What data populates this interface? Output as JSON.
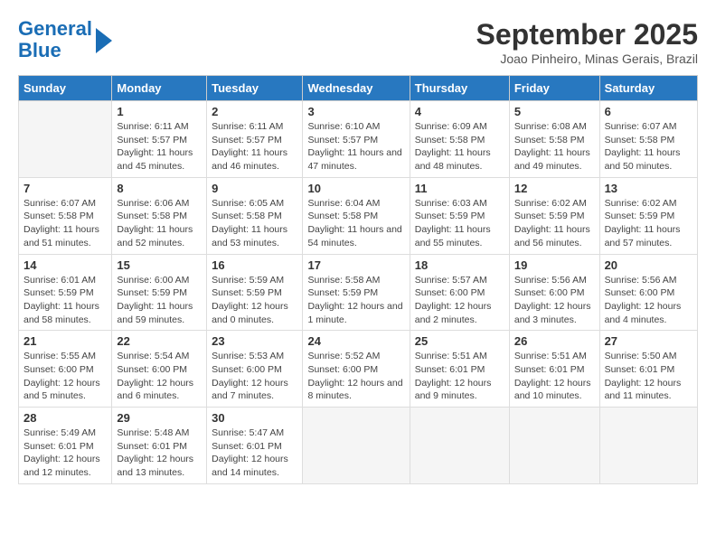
{
  "header": {
    "logo_line1": "General",
    "logo_line2": "Blue",
    "title": "September 2025",
    "subtitle": "Joao Pinheiro, Minas Gerais, Brazil"
  },
  "calendar": {
    "days_of_week": [
      "Sunday",
      "Monday",
      "Tuesday",
      "Wednesday",
      "Thursday",
      "Friday",
      "Saturday"
    ],
    "weeks": [
      [
        {
          "day": "",
          "empty": true
        },
        {
          "day": "1",
          "sunrise": "6:11 AM",
          "sunset": "5:57 PM",
          "daylight": "11 hours and 45 minutes."
        },
        {
          "day": "2",
          "sunrise": "6:11 AM",
          "sunset": "5:57 PM",
          "daylight": "11 hours and 46 minutes."
        },
        {
          "day": "3",
          "sunrise": "6:10 AM",
          "sunset": "5:57 PM",
          "daylight": "11 hours and 47 minutes."
        },
        {
          "day": "4",
          "sunrise": "6:09 AM",
          "sunset": "5:58 PM",
          "daylight": "11 hours and 48 minutes."
        },
        {
          "day": "5",
          "sunrise": "6:08 AM",
          "sunset": "5:58 PM",
          "daylight": "11 hours and 49 minutes."
        },
        {
          "day": "6",
          "sunrise": "6:07 AM",
          "sunset": "5:58 PM",
          "daylight": "11 hours and 50 minutes."
        }
      ],
      [
        {
          "day": "7",
          "sunrise": "6:07 AM",
          "sunset": "5:58 PM",
          "daylight": "11 hours and 51 minutes."
        },
        {
          "day": "8",
          "sunrise": "6:06 AM",
          "sunset": "5:58 PM",
          "daylight": "11 hours and 52 minutes."
        },
        {
          "day": "9",
          "sunrise": "6:05 AM",
          "sunset": "5:58 PM",
          "daylight": "11 hours and 53 minutes."
        },
        {
          "day": "10",
          "sunrise": "6:04 AM",
          "sunset": "5:58 PM",
          "daylight": "11 hours and 54 minutes."
        },
        {
          "day": "11",
          "sunrise": "6:03 AM",
          "sunset": "5:59 PM",
          "daylight": "11 hours and 55 minutes."
        },
        {
          "day": "12",
          "sunrise": "6:02 AM",
          "sunset": "5:59 PM",
          "daylight": "11 hours and 56 minutes."
        },
        {
          "day": "13",
          "sunrise": "6:02 AM",
          "sunset": "5:59 PM",
          "daylight": "11 hours and 57 minutes."
        }
      ],
      [
        {
          "day": "14",
          "sunrise": "6:01 AM",
          "sunset": "5:59 PM",
          "daylight": "11 hours and 58 minutes."
        },
        {
          "day": "15",
          "sunrise": "6:00 AM",
          "sunset": "5:59 PM",
          "daylight": "11 hours and 59 minutes."
        },
        {
          "day": "16",
          "sunrise": "5:59 AM",
          "sunset": "5:59 PM",
          "daylight": "12 hours and 0 minutes."
        },
        {
          "day": "17",
          "sunrise": "5:58 AM",
          "sunset": "5:59 PM",
          "daylight": "12 hours and 1 minute."
        },
        {
          "day": "18",
          "sunrise": "5:57 AM",
          "sunset": "6:00 PM",
          "daylight": "12 hours and 2 minutes."
        },
        {
          "day": "19",
          "sunrise": "5:56 AM",
          "sunset": "6:00 PM",
          "daylight": "12 hours and 3 minutes."
        },
        {
          "day": "20",
          "sunrise": "5:56 AM",
          "sunset": "6:00 PM",
          "daylight": "12 hours and 4 minutes."
        }
      ],
      [
        {
          "day": "21",
          "sunrise": "5:55 AM",
          "sunset": "6:00 PM",
          "daylight": "12 hours and 5 minutes."
        },
        {
          "day": "22",
          "sunrise": "5:54 AM",
          "sunset": "6:00 PM",
          "daylight": "12 hours and 6 minutes."
        },
        {
          "day": "23",
          "sunrise": "5:53 AM",
          "sunset": "6:00 PM",
          "daylight": "12 hours and 7 minutes."
        },
        {
          "day": "24",
          "sunrise": "5:52 AM",
          "sunset": "6:00 PM",
          "daylight": "12 hours and 8 minutes."
        },
        {
          "day": "25",
          "sunrise": "5:51 AM",
          "sunset": "6:01 PM",
          "daylight": "12 hours and 9 minutes."
        },
        {
          "day": "26",
          "sunrise": "5:51 AM",
          "sunset": "6:01 PM",
          "daylight": "12 hours and 10 minutes."
        },
        {
          "day": "27",
          "sunrise": "5:50 AM",
          "sunset": "6:01 PM",
          "daylight": "12 hours and 11 minutes."
        }
      ],
      [
        {
          "day": "28",
          "sunrise": "5:49 AM",
          "sunset": "6:01 PM",
          "daylight": "12 hours and 12 minutes."
        },
        {
          "day": "29",
          "sunrise": "5:48 AM",
          "sunset": "6:01 PM",
          "daylight": "12 hours and 13 minutes."
        },
        {
          "day": "30",
          "sunrise": "5:47 AM",
          "sunset": "6:01 PM",
          "daylight": "12 hours and 14 minutes."
        },
        {
          "day": "",
          "empty": true
        },
        {
          "day": "",
          "empty": true
        },
        {
          "day": "",
          "empty": true
        },
        {
          "day": "",
          "empty": true
        }
      ]
    ]
  }
}
